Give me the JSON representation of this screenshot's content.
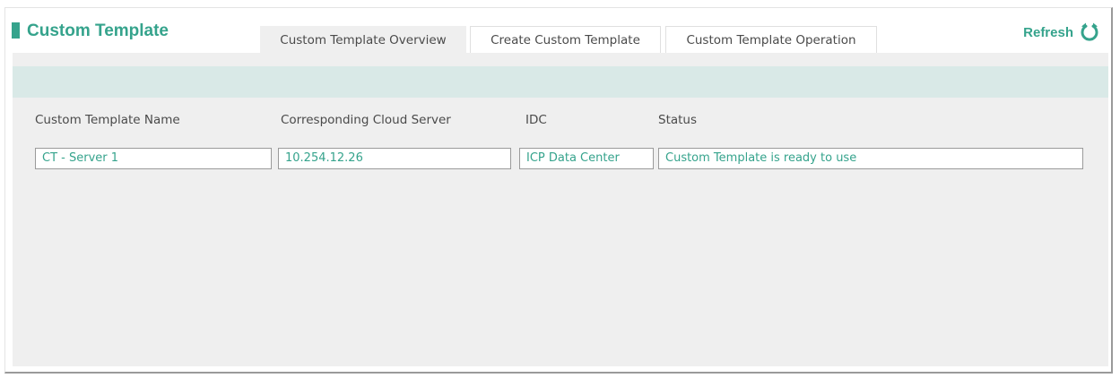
{
  "header": {
    "title": "Custom Template",
    "refresh_label": "Refresh"
  },
  "tabs": [
    {
      "label": "Custom Template Overview",
      "active": true
    },
    {
      "label": "Create Custom Template",
      "active": false
    },
    {
      "label": "Custom Template Operation",
      "active": false
    }
  ],
  "table": {
    "columns": [
      "Custom Template Name",
      "Corresponding Cloud Server",
      "IDC",
      "Status"
    ],
    "rows": [
      [
        "CT - Server 1",
        "10.254.12.26",
        "ICP Data Center",
        "Custom Template is ready to use"
      ]
    ]
  },
  "colors": {
    "accent": "#35a38c",
    "content_bg": "#efefef",
    "toolbar_bg": "#d9e9e7"
  },
  "icons": {
    "refresh": "refresh-icon"
  }
}
